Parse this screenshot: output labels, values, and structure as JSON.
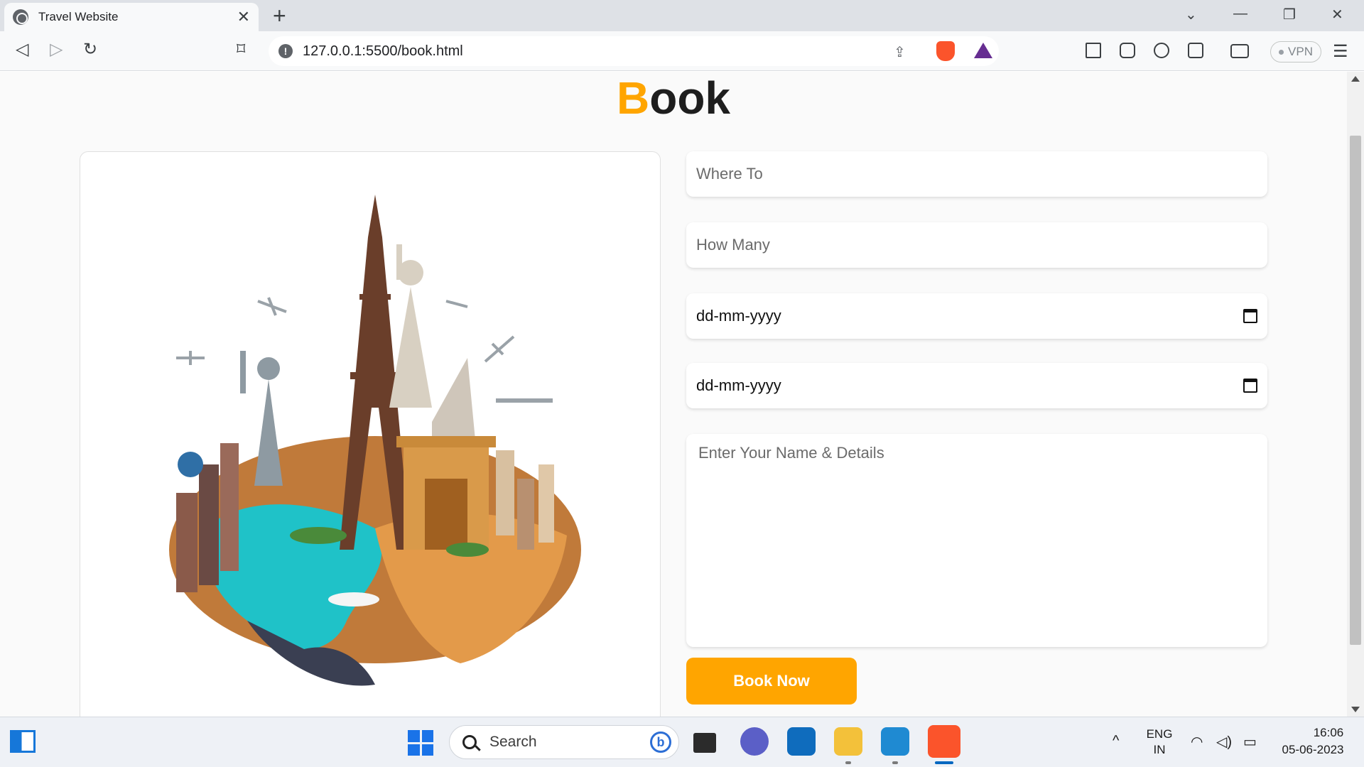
{
  "browser": {
    "tab_title": "Travel Website",
    "tab_close": "✕",
    "new_tab": "+",
    "url": "127.0.0.1:5500/book.html",
    "info_icon": "!",
    "vpn_label": "VPN",
    "menu": "☰",
    "window_controls": {
      "dropdown": "⌄",
      "minimize": "—",
      "restore": "❐",
      "close": "✕"
    },
    "nav": {
      "back": "◁",
      "forward": "▷",
      "reload": "↻",
      "bookmark": "⌑"
    }
  },
  "page": {
    "heading_first": "B",
    "heading_rest": "ook",
    "form": {
      "where_to_placeholder": "Where To",
      "how_many_placeholder": "How Many",
      "arrival_date_placeholder": "dd-mm-yyyy",
      "leaving_date_placeholder": "dd-mm-yyyy",
      "details_placeholder": "Enter Your Name & Details",
      "submit_label": "Book Now"
    },
    "accent_color": "#ffa500"
  },
  "taskbar": {
    "search_label": "Search",
    "bing_label": "b",
    "language_line1": "ENG",
    "language_line2": "IN",
    "time": "16:06",
    "date": "05-06-2023",
    "chevron": "^"
  }
}
